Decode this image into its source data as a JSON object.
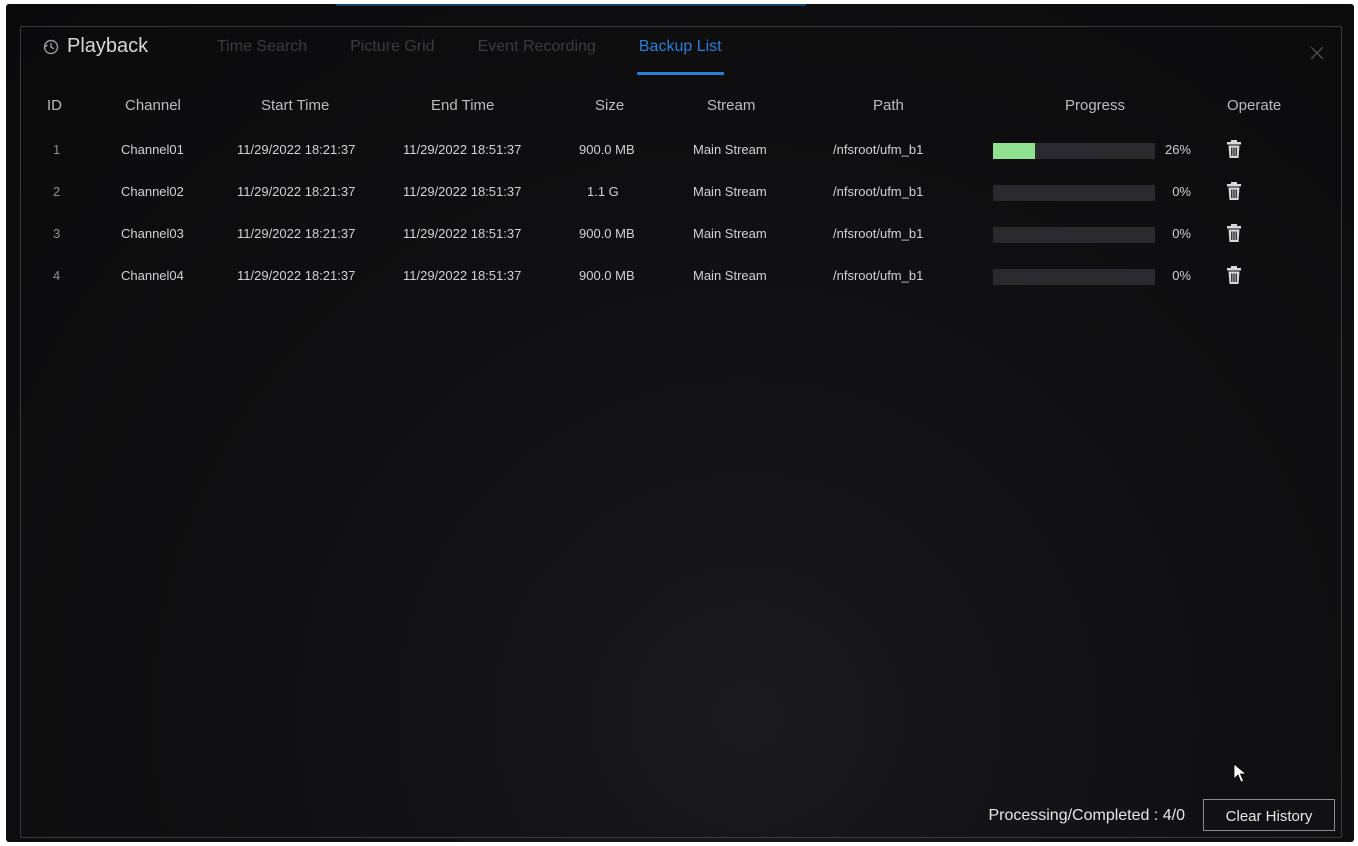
{
  "header": {
    "title": "Playback",
    "title_icon": "playback-clock-icon",
    "close_icon": "close-icon"
  },
  "tabs": [
    {
      "label": "Time Search",
      "active": false
    },
    {
      "label": "Picture Grid",
      "active": false
    },
    {
      "label": "Event Recording",
      "active": false
    },
    {
      "label": "Backup List",
      "active": true
    }
  ],
  "table": {
    "columns": [
      "ID",
      "Channel",
      "Start Time",
      "End Time",
      "Size",
      "Stream",
      "Path",
      "Progress",
      "Operate"
    ],
    "rows": [
      {
        "id": "1",
        "channel": "Channel01",
        "start": "11/29/2022 18:21:37",
        "end": "11/29/2022 18:51:37",
        "size": "900.0 MB",
        "stream": "Main Stream",
        "path": "/nfsroot/ufm_b1",
        "progress": 26,
        "progress_text": "26%",
        "operate_icon": "trash-icon"
      },
      {
        "id": "2",
        "channel": "Channel02",
        "start": "11/29/2022 18:21:37",
        "end": "11/29/2022 18:51:37",
        "size": "1.1 G",
        "stream": "Main Stream",
        "path": "/nfsroot/ufm_b1",
        "progress": 0,
        "progress_text": "0%",
        "operate_icon": "trash-icon"
      },
      {
        "id": "3",
        "channel": "Channel03",
        "start": "11/29/2022 18:21:37",
        "end": "11/29/2022 18:51:37",
        "size": "900.0 MB",
        "stream": "Main Stream",
        "path": "/nfsroot/ufm_b1",
        "progress": 0,
        "progress_text": "0%",
        "operate_icon": "trash-icon"
      },
      {
        "id": "4",
        "channel": "Channel04",
        "start": "11/29/2022 18:21:37",
        "end": "11/29/2022 18:51:37",
        "size": "900.0 MB",
        "stream": "Main Stream",
        "path": "/nfsroot/ufm_b1",
        "progress": 0,
        "progress_text": "0%",
        "operate_icon": "trash-icon"
      }
    ]
  },
  "footer": {
    "status_text": "Processing/Completed : 4/0",
    "clear_button": "Clear History"
  },
  "colors": {
    "accent": "#2f7fd6",
    "progress_fill": "#8fe08f",
    "background": "#0b0b0c"
  }
}
